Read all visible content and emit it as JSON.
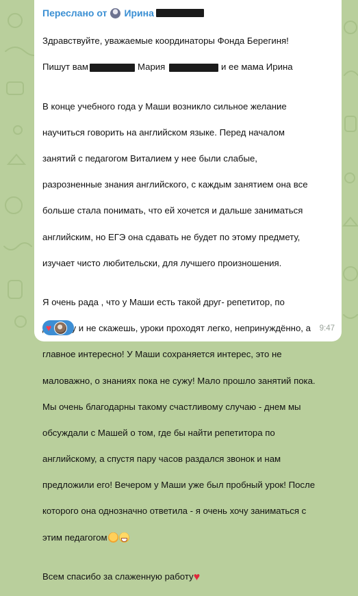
{
  "forward": {
    "prefix": "Переслано от",
    "name": "Ирина"
  },
  "message": {
    "p1_l1": "Здравствуйте, уважаемые координаторы Фонда Берегиня!",
    "p1_l2_a": "Пишут вам",
    "p1_l2_b": "Мария",
    "p1_l2_c": "и ее мама Ирина",
    "p2": [
      "В конце учебного года у Маши возникло сильное желание",
      "научиться говорить на английском языке. Перед началом",
      "занятий с педагогом Виталием у нее были слабые,",
      "разрозненные знания английского, с каждым занятием она все",
      "больше стала понимать, что ей хочется и дальше заниматься",
      "английским, но ЕГЭ она сдавать не будет по этому предмету,",
      "изучает чисто любительски, для лучшего произношения."
    ],
    "p3": [
      "Я очень рада , что у Маши есть такой друг- репетитор, по",
      "другому и не скажешь, уроки проходят легко, непринуждённо, а",
      "главное интересно! У Маши сохраняется интерес, это не",
      "маловажно, о знаниях пока не сужу! Мало прошло занятий пока.",
      "Мы очень благодарны такому счастливому случаю - днем мы",
      "обсуждали с Машей о том, где бы найти репетитора по",
      "английскому, а спустя пару часов раздался звонок и нам",
      "предложили его! Вечером у Маши уже был пробный урок! После",
      "которого она однозначно ответила - я очень хочу заниматься с"
    ],
    "p3_last": "этим педагогом",
    "p4": "Всем спасибо за слаженную работу"
  },
  "reaction": {
    "emoji": "heart-icon"
  },
  "time": "9:47",
  "colors": {
    "accent": "#3a8fd3",
    "background": "#b9cf9c",
    "bubble": "#ffffff",
    "reaction": "#3d8ed4"
  }
}
